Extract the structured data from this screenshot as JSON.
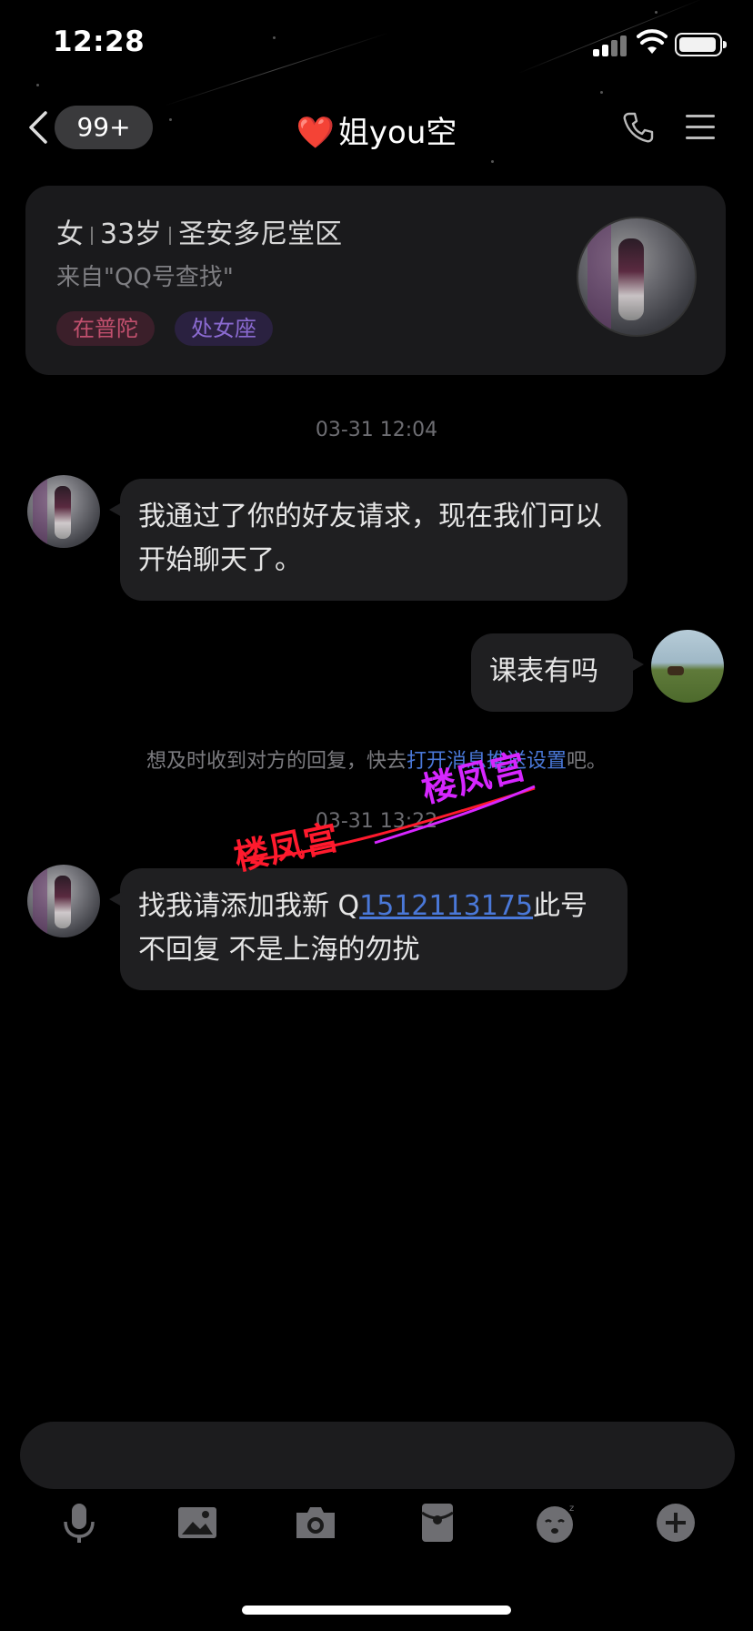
{
  "status_bar": {
    "time": "12:28"
  },
  "header": {
    "back_badge": "99+",
    "title_heart": "❤️",
    "title": "姐you空"
  },
  "profile": {
    "gender": "女",
    "age": "33岁",
    "location": "圣安多尼堂区",
    "source": "来自\"QQ号查找\"",
    "tags": [
      "在普陀",
      "处女座"
    ]
  },
  "chat": {
    "timestamp_1": "03-31 12:04",
    "msg_1": "我通过了你的好友请求，现在我们可以开始聊天了。",
    "msg_2": "课表有吗",
    "notice_prefix": "想及时收到对方的回复，快去",
    "notice_link": "打开消息推送设置",
    "notice_suffix": "吧。",
    "timestamp_2": "03-31 13:22",
    "msg_3_prefix": "找我请添加我新 Q",
    "msg_3_number": "1512113175",
    "msg_3_suffix": "此号不回复 不是上海的勿扰"
  },
  "watermark": {
    "text": "楼凤宫"
  },
  "colors": {
    "background": "#000000",
    "bubble": "#1f1f21",
    "link": "#4a78d8",
    "heart": "#e8384f",
    "watermark_red": "#ff1a2d",
    "watermark_purple": "#d626ff"
  },
  "icons": {
    "toolbar": [
      "microphone-icon",
      "image-icon",
      "camera-icon",
      "red-packet-icon",
      "emoji-icon",
      "plus-icon"
    ]
  }
}
